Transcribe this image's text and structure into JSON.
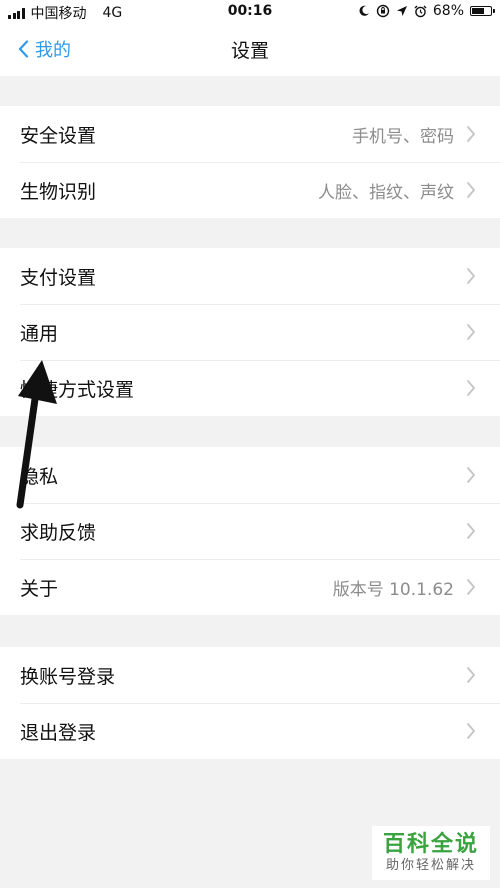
{
  "status_bar": {
    "carrier": "中国移动",
    "network": "4G",
    "time": "00:16",
    "battery_percent": "68%",
    "battery_level": 0.68,
    "icons": [
      "moon-icon",
      "rotation-lock-icon",
      "location-icon",
      "alarm-icon",
      "battery-icon"
    ]
  },
  "nav": {
    "back_label": "我的",
    "title": "设置"
  },
  "groups": [
    {
      "items": [
        {
          "label": "安全设置",
          "value": "手机号、密码"
        },
        {
          "label": "生物识别",
          "value": "人脸、指纹、声纹"
        }
      ]
    },
    {
      "items": [
        {
          "label": "支付设置",
          "value": ""
        },
        {
          "label": "通用",
          "value": ""
        },
        {
          "label": "快捷方式设置",
          "value": ""
        }
      ]
    },
    {
      "items": [
        {
          "label": "隐私",
          "value": ""
        },
        {
          "label": "求助反馈",
          "value": ""
        },
        {
          "label": "关于",
          "value": "版本号 10.1.62"
        }
      ]
    },
    {
      "items": [
        {
          "label": "换账号登录",
          "value": ""
        },
        {
          "label": "退出登录",
          "value": ""
        }
      ]
    }
  ],
  "watermark": {
    "title": "百科全说",
    "subtitle": "助你轻松解决"
  },
  "colors": {
    "accent": "#2f9be8",
    "background": "#f2f2f2",
    "watermark_green": "#3aa340"
  }
}
